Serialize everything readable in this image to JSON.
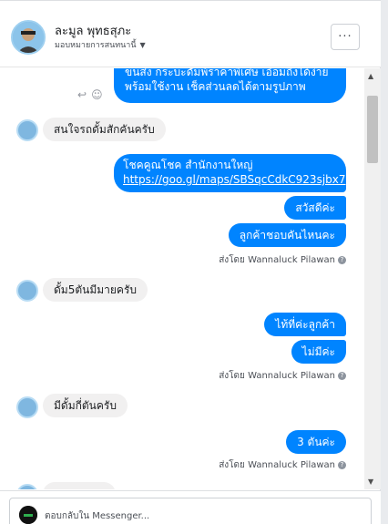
{
  "header": {
    "name": "ละมูล พุทธสุภะ",
    "subtitle": "มอบหมายการสนทนานี้",
    "more_label": "···"
  },
  "messages": {
    "m1_line1": "ขนส่ง กระบะดั้มพ์ราคาพิเศษ เอื้อมถึงได้ง่าย",
    "m1_line2": "พร้อมใช้งาน เช็คส่วนลดได้ตามรูปภาพ",
    "m2": "สนใจรถดั้มสักคันครับ",
    "m3_line1": "โชคคูณโชค สำนักงานใหญ่",
    "m3_link": "https://goo.gl/maps/SBSqcCdkC923sjbx7",
    "m4": "สวัสดีค่ะ",
    "m5": "ลูกค้าชอบคันไหนคะ",
    "m6": "ดั้ม5ตันมีมายครับ",
    "m7": "ไท้ที่ค่ะลูกค้า",
    "m8": "ไม่มีค่ะ",
    "m9": "มีดั้มกี่ตันครับ",
    "m10": "3 ตันค่ะ"
  },
  "sent_by": "ส่งโดย Wannaluck Pilawan",
  "composer": {
    "placeholder": "ตอบกลับใน Messenger..."
  },
  "colors": {
    "outgoing": "#0084ff",
    "incoming": "#f1f0f0"
  }
}
